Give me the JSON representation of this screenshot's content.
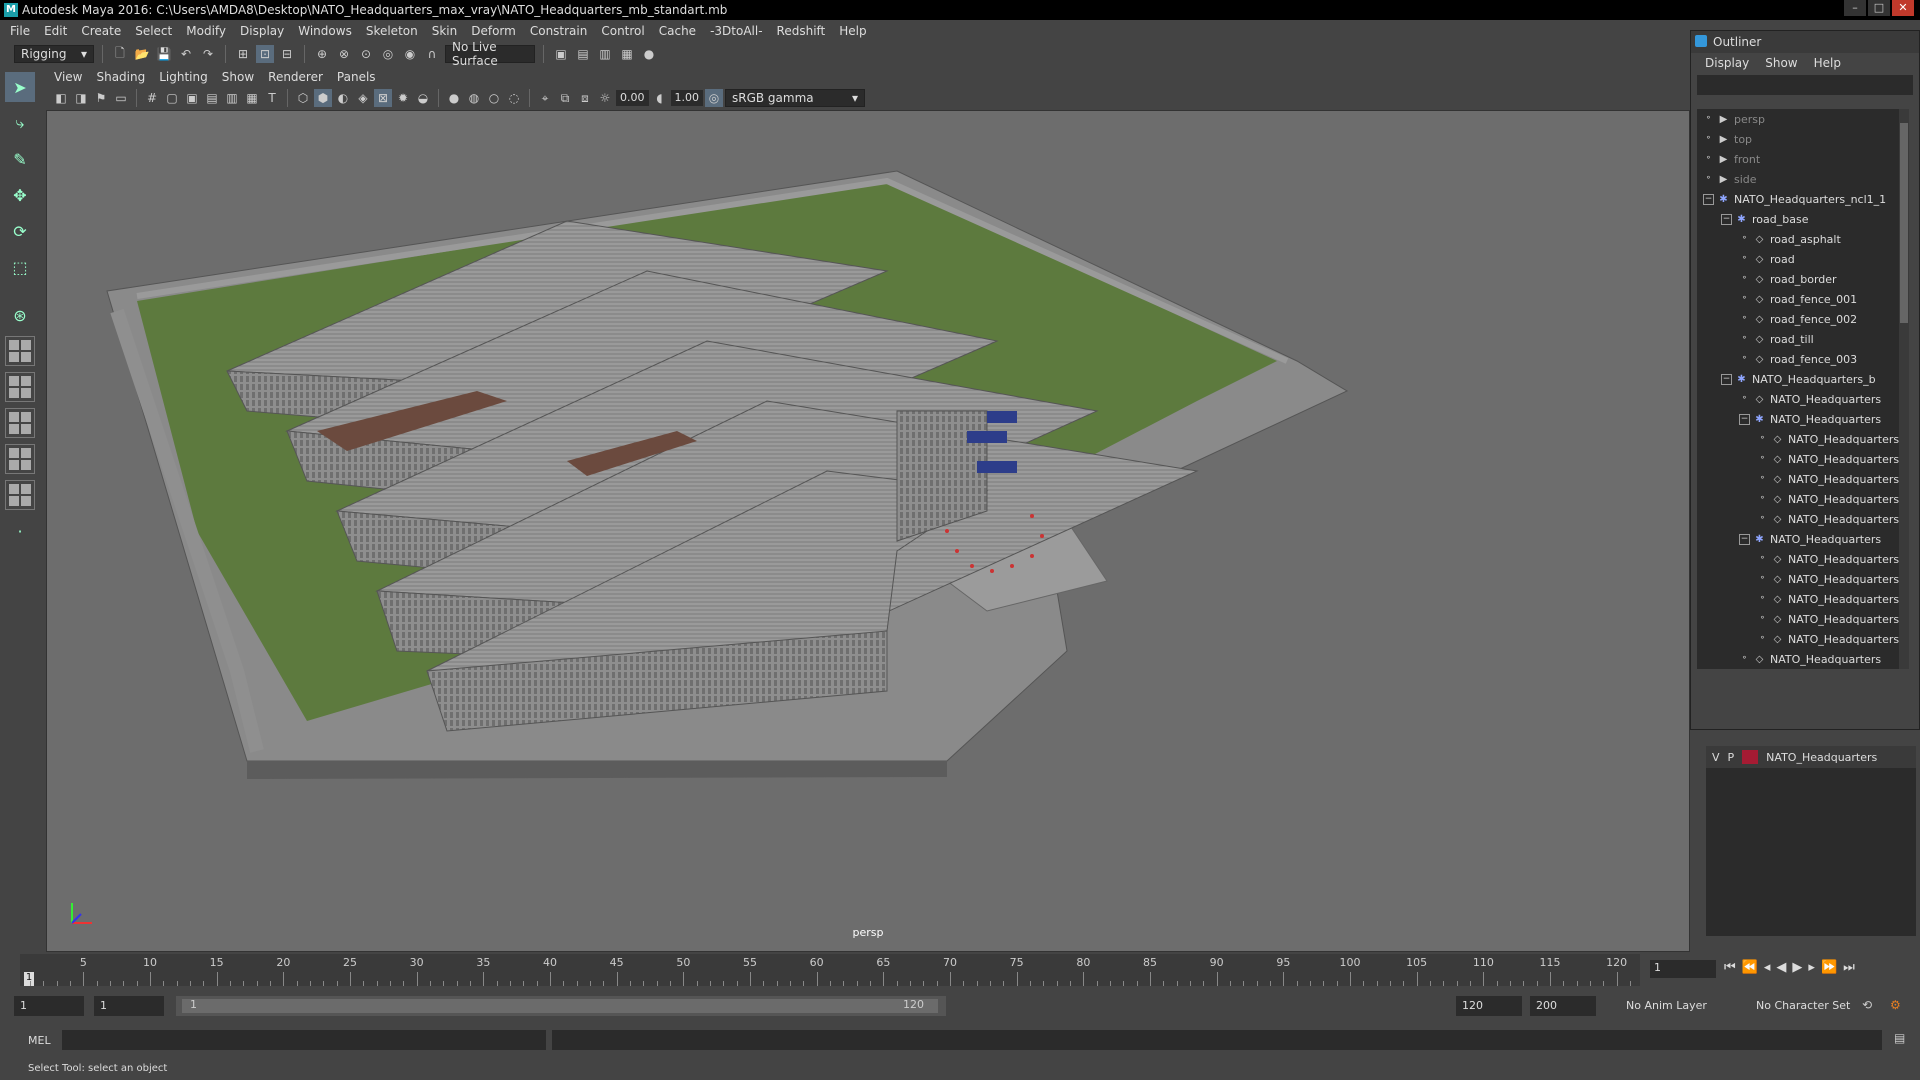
{
  "window": {
    "title": "Autodesk Maya 2016: C:\\Users\\AMDA8\\Desktop\\NATO_Headquarters_max_vray\\NATO_Headquarters_mb_standart.mb"
  },
  "menubar": [
    "File",
    "Edit",
    "Create",
    "Select",
    "Modify",
    "Display",
    "Windows",
    "Skeleton",
    "Skin",
    "Deform",
    "Constrain",
    "Control",
    "Cache",
    "-3DtoAll-",
    "Redshift",
    "Help"
  ],
  "statusline": {
    "menuset": "Rigging",
    "live_surface": "No Live Surface"
  },
  "viewport": {
    "menus": [
      "View",
      "Shading",
      "Lighting",
      "Show",
      "Renderer",
      "Panels"
    ],
    "exposure": "0.00",
    "gamma": "1.00",
    "colorspace": "sRGB gamma",
    "camera": "persp"
  },
  "outliner": {
    "title": "Outliner",
    "menus": [
      "Display",
      "Show",
      "Help"
    ],
    "items": [
      {
        "label": "persp",
        "type": "camera",
        "depth": 0,
        "dim": true
      },
      {
        "label": "top",
        "type": "camera",
        "depth": 0,
        "dim": true
      },
      {
        "label": "front",
        "type": "camera",
        "depth": 0,
        "dim": true
      },
      {
        "label": "side",
        "type": "camera",
        "depth": 0,
        "dim": true
      },
      {
        "label": "NATO_Headquarters_ncl1_1",
        "type": "group",
        "depth": 0,
        "expanded": true
      },
      {
        "label": "road_base",
        "type": "group",
        "depth": 1,
        "expanded": true
      },
      {
        "label": "road_asphalt",
        "type": "mesh",
        "depth": 2
      },
      {
        "label": "road",
        "type": "mesh",
        "depth": 2
      },
      {
        "label": "road_border",
        "type": "mesh",
        "depth": 2
      },
      {
        "label": "road_fence_001",
        "type": "mesh",
        "depth": 2
      },
      {
        "label": "road_fence_002",
        "type": "mesh",
        "depth": 2
      },
      {
        "label": "road_till",
        "type": "mesh",
        "depth": 2
      },
      {
        "label": "road_fence_003",
        "type": "mesh",
        "depth": 2
      },
      {
        "label": "NATO_Headquarters_b",
        "type": "group",
        "depth": 1,
        "expanded": true
      },
      {
        "label": "NATO_Headquarters",
        "type": "mesh",
        "depth": 2
      },
      {
        "label": "NATO_Headquarters",
        "type": "group",
        "depth": 2,
        "expanded": true
      },
      {
        "label": "NATO_Headquarters",
        "type": "mesh",
        "depth": 3
      },
      {
        "label": "NATO_Headquarters",
        "type": "mesh",
        "depth": 3
      },
      {
        "label": "NATO_Headquarters",
        "type": "mesh",
        "depth": 3
      },
      {
        "label": "NATO_Headquarters",
        "type": "mesh",
        "depth": 3
      },
      {
        "label": "NATO_Headquarters",
        "type": "mesh",
        "depth": 3
      },
      {
        "label": "NATO_Headquarters",
        "type": "group",
        "depth": 2,
        "expanded": true
      },
      {
        "label": "NATO_Headquarters",
        "type": "mesh",
        "depth": 3
      },
      {
        "label": "NATO_Headquarters",
        "type": "mesh",
        "depth": 3
      },
      {
        "label": "NATO_Headquarters",
        "type": "mesh",
        "depth": 3
      },
      {
        "label": "NATO_Headquarters",
        "type": "mesh",
        "depth": 3
      },
      {
        "label": "NATO_Headquarters",
        "type": "mesh",
        "depth": 3
      },
      {
        "label": "NATO_Headquarters",
        "type": "mesh",
        "depth": 2
      },
      {
        "label": "NATO_Headquarters",
        "type": "mesh",
        "depth": 2
      },
      {
        "label": "NATO_Headquarters",
        "type": "mesh",
        "depth": 2
      }
    ]
  },
  "layers": {
    "v": "V",
    "p": "P",
    "name": "NATO_Headquarters",
    "color": "#a51b33"
  },
  "timeline": {
    "ticks": [
      5,
      10,
      15,
      20,
      25,
      30,
      35,
      40,
      45,
      50,
      55,
      60,
      65,
      70,
      75,
      80,
      85,
      90,
      95,
      100,
      105,
      110,
      115,
      120
    ],
    "min": 1,
    "max": 121,
    "current_frame": "1",
    "frame_input": "1"
  },
  "range": {
    "start": "1",
    "playback_start": "1",
    "slider_start": "1",
    "slider_end": "120",
    "playback_end": "120",
    "end": "200",
    "anim_layer": "No Anim Layer",
    "character_set": "No Character Set"
  },
  "command": {
    "lang": "MEL"
  },
  "help": "Select Tool: select an object"
}
